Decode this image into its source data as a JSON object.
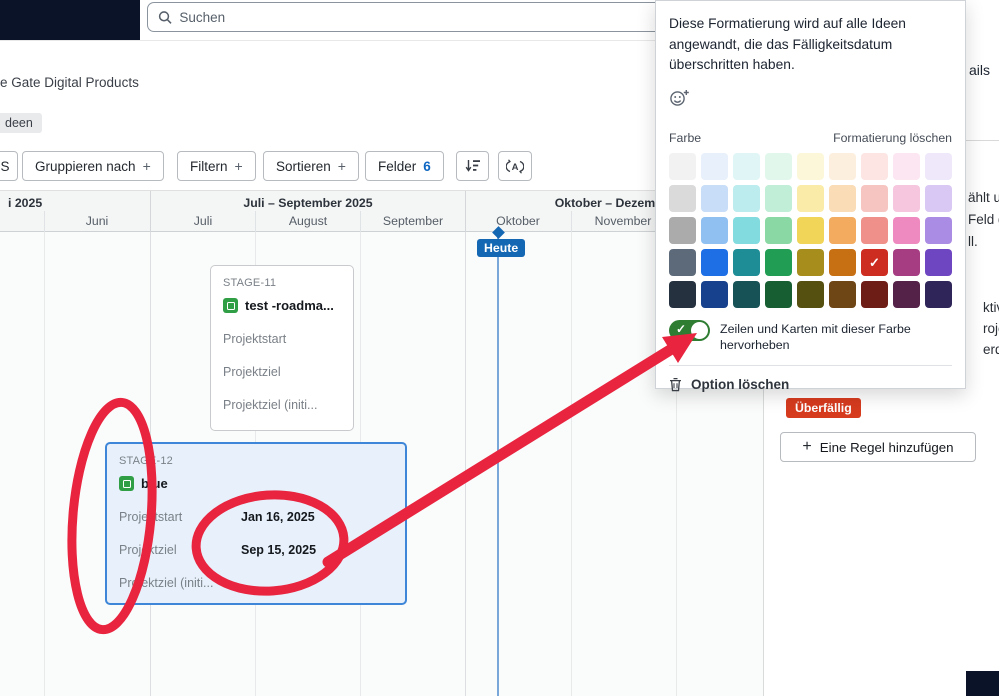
{
  "search": {
    "placeholder": "Suchen"
  },
  "page": {
    "title_fragment": "e Gate Digital Products",
    "ideas_badge_fragment": "deen",
    "left_button_fragment": "S"
  },
  "toolbar": {
    "group_by_label": "Gruppieren nach",
    "filter_label": "Filtern",
    "sort_label": "Sortieren",
    "fields_label": "Felder",
    "fields_count": "6"
  },
  "glyphs": {
    "plus": "+",
    "check": "✓"
  },
  "timeline": {
    "quarters": [
      "i 2025",
      "Juli – September 2025",
      "Oktober – Dezember"
    ],
    "months": [
      "Juni",
      "Juli",
      "August",
      "September",
      "Oktober",
      "November"
    ],
    "today_label": "Heute"
  },
  "cards": [
    {
      "id": "STAGE-11",
      "title": "test -roadma...",
      "fields": [
        {
          "label": "Projektstart",
          "value": ""
        },
        {
          "label": "Projektziel",
          "value": ""
        },
        {
          "label": "Projektziel (initi...",
          "value": ""
        }
      ]
    },
    {
      "id": "STAGE-12",
      "title": "blue",
      "fields": [
        {
          "label": "Projektstart",
          "value": "Jan 16, 2025"
        },
        {
          "label": "Projektziel",
          "value": "Sep 15, 2025"
        },
        {
          "label": "Projektziel (initi...",
          "value": ""
        }
      ]
    }
  ],
  "popup": {
    "description": "Diese Formatierung wird auf alle Ideen angewandt, die das Fälligkeitsdatum überschritten haben.",
    "color_section_label": "Farbe",
    "clear_formatting_label": "Formatierung löschen",
    "highlight_toggle_label": "Zeilen und Karten mit dieser Farbe hervorheben",
    "toggle_state": "on",
    "delete_option_label": "Option löschen",
    "palette": {
      "selected": {
        "row": 3,
        "col": 6
      },
      "rows": [
        [
          "#f2f2f2",
          "#e7f0fb",
          "#e0f6f6",
          "#e2f7ec",
          "#fdf7da",
          "#fdefde",
          "#fce5e2",
          "#fce6f1",
          "#efe8fa"
        ],
        [
          "#dadada",
          "#c7ddf8",
          "#bcecee",
          "#c0eed6",
          "#faeca8",
          "#fadcb6",
          "#f7c5c1",
          "#f6c6df",
          "#d8c8f3"
        ],
        [
          "#ababab",
          "#8fc0f1",
          "#82dbde",
          "#8ad8a4",
          "#f0d558",
          "#f3ab60",
          "#ef918a",
          "#ef8ac0",
          "#ab8ce4"
        ],
        [
          "#5d6a79",
          "#1e6fe6",
          "#1e8d95",
          "#219e53",
          "#a68d1c",
          "#c76f13",
          "#cc2d20",
          "#a63c82",
          "#6f46c2"
        ],
        [
          "#25313f",
          "#17418c",
          "#175257",
          "#175e33",
          "#55500f",
          "#6e4616",
          "#6e1c16",
          "#542148",
          "#2f2558"
        ]
      ]
    }
  },
  "right_panel": {
    "details_fragment": "ails",
    "text_fragments": [
      "ählt u",
      "Feld g",
      "ll.",
      "ktivier",
      "rojekte",
      "erden"
    ],
    "overdue_badge": "Überfällig",
    "add_rule_label": "Eine Regel hinzufügen"
  },
  "colors": {
    "today_blue": "#1467b3",
    "annotation_red": "#e8243f",
    "overdue_red": "#d63b1e",
    "toggle_green": "#2e7d32",
    "selected_card_border": "#3d86d8",
    "selected_card_bg": "#e8f1fb"
  }
}
